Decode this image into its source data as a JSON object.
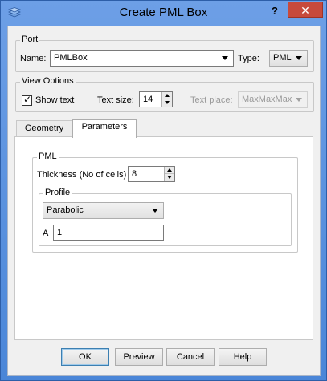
{
  "window": {
    "title": "Create PML Box",
    "help_label": "?",
    "close_label": "✕"
  },
  "port": {
    "title": "Port",
    "name_label": "Name:",
    "name_value": "PMLBox",
    "type_label": "Type:",
    "type_value": "PML"
  },
  "view_options": {
    "title": "View Options",
    "show_text_label": "Show text",
    "show_text_checked": true,
    "text_size_label": "Text size:",
    "text_size_value": "14",
    "text_place_label": "Text place:",
    "text_place_value": "MaxMaxMax"
  },
  "tabs": [
    {
      "label": "Geometry",
      "active": false
    },
    {
      "label": "Parameters",
      "active": true
    }
  ],
  "pml": {
    "title": "PML",
    "thickness_label": "Thickness (No of cells)",
    "thickness_value": "8",
    "profile": {
      "title": "Profile",
      "type_value": "Parabolic",
      "a_label": "A",
      "a_value": "1"
    }
  },
  "buttons": {
    "ok": "OK",
    "preview": "Preview",
    "cancel": "Cancel",
    "help": "Help"
  },
  "colors": {
    "title_bar": "#5a93de",
    "close_button": "#c74a3c",
    "dialog_bg": "#f0f0f0"
  }
}
